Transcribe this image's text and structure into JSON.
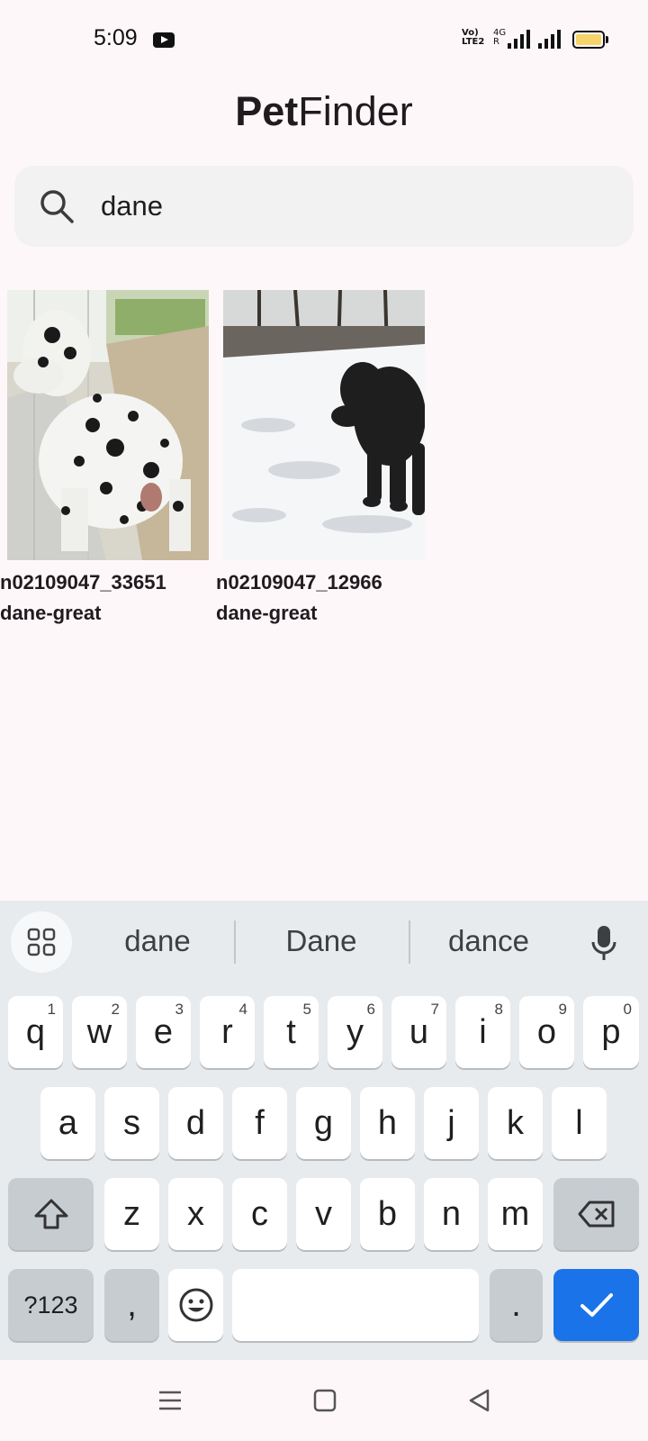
{
  "status": {
    "time": "5:09",
    "volte_label": "Vo) LTE2",
    "net_label": "4G R",
    "battery_color": "#f6d46b"
  },
  "header": {
    "title_bold": "Pet",
    "title_regular": "Finder"
  },
  "search": {
    "value": "dane",
    "icon": "search-icon"
  },
  "results": [
    {
      "id": "n02109047_33651",
      "breed": "dane-great"
    },
    {
      "id": "n02109047_12966",
      "breed": "dane-great"
    }
  ],
  "keyboard": {
    "suggestions": [
      "dane",
      "Dane",
      "dance"
    ],
    "row1": [
      {
        "key": "q",
        "hint": "1"
      },
      {
        "key": "w",
        "hint": "2"
      },
      {
        "key": "e",
        "hint": "3"
      },
      {
        "key": "r",
        "hint": "4"
      },
      {
        "key": "t",
        "hint": "5"
      },
      {
        "key": "y",
        "hint": "6"
      },
      {
        "key": "u",
        "hint": "7"
      },
      {
        "key": "i",
        "hint": "8"
      },
      {
        "key": "o",
        "hint": "9"
      },
      {
        "key": "p",
        "hint": "0"
      }
    ],
    "row2": [
      "a",
      "s",
      "d",
      "f",
      "g",
      "h",
      "j",
      "k",
      "l"
    ],
    "row3": [
      "z",
      "x",
      "c",
      "v",
      "b",
      "n",
      "m"
    ],
    "symbols_label": "?123",
    "comma_label": ",",
    "period_label": ".",
    "accent_color": "#1a73e8"
  },
  "nav": {
    "menu_icon": "menu-icon",
    "home_icon": "home-icon",
    "back_icon": "back-icon"
  }
}
